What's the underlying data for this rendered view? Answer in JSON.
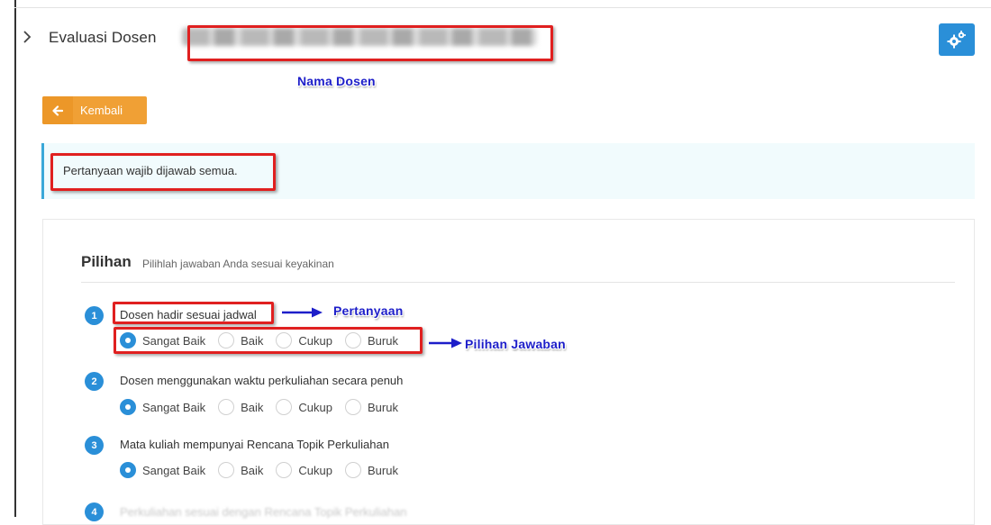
{
  "header": {
    "title": "Evaluasi Dosen",
    "lecturer_name_redacted": true
  },
  "callouts": {
    "nama_dosen": "Nama Dosen",
    "pertanyaan": "Pertanyaan",
    "pilihan_jawaban": "Pilihan Jawaban"
  },
  "back_button": {
    "label": "Kembali"
  },
  "alert": {
    "text": "Pertanyaan wajib dijawab semua."
  },
  "section": {
    "title": "Pilihan",
    "subtitle": "Pilihlah jawaban Anda sesuai keyakinan"
  },
  "options": [
    "Sangat Baik",
    "Baik",
    "Cukup",
    "Buruk"
  ],
  "questions": [
    {
      "number": "1",
      "text": "Dosen hadir sesuai jadwal",
      "selected": "Sangat Baik"
    },
    {
      "number": "2",
      "text": "Dosen menggunakan waktu perkuliahan secara penuh",
      "selected": "Sangat Baik"
    },
    {
      "number": "3",
      "text": "Mata kuliah mempunyai Rencana Topik Perkuliahan",
      "selected": "Sangat Baik"
    },
    {
      "number": "4",
      "text": "Perkuliahan sesuai dengan Rencana Topik Perkuliahan",
      "selected": ""
    }
  ],
  "colors": {
    "primary": "#2a8fd8",
    "warning": "#f0a035",
    "annotation_red": "#e02020",
    "annotation_blue": "#1d1ec9"
  },
  "icons": {
    "breadcrumb": "chevron-right-icon",
    "settings": "gears-icon",
    "back": "arrow-left-icon"
  }
}
